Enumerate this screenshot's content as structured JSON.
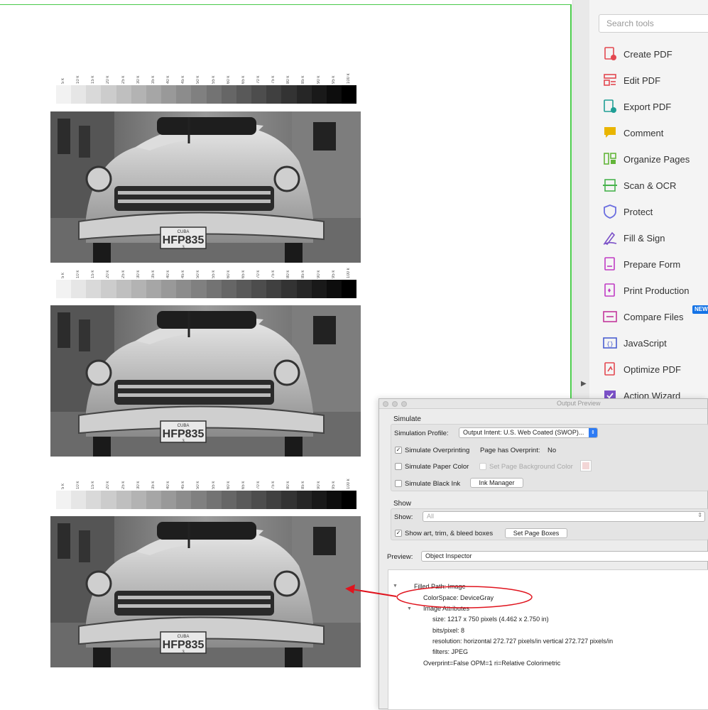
{
  "scale_labels": [
    "5 k",
    "10 k",
    "15 k",
    "20 k",
    "25 k",
    "30 k",
    "35 k",
    "40 k",
    "45 k",
    "50 k",
    "55 k",
    "60 k",
    "65 k",
    "70 k",
    "75 k",
    "80 k",
    "85 k",
    "90 k",
    "95 k",
    "100 k"
  ],
  "scale_levels_percent": [
    5,
    10,
    15,
    20,
    25,
    30,
    35,
    40,
    45,
    50,
    55,
    60,
    65,
    70,
    75,
    80,
    85,
    90,
    95,
    100
  ],
  "photo": {
    "plate": "HFP835",
    "plate_top": "CUBA",
    "plate_bottom": "3"
  },
  "tools": {
    "search_placeholder": "Search tools",
    "items": [
      {
        "label": "Create PDF",
        "icon": "create-pdf-icon",
        "color": "#e34850"
      },
      {
        "label": "Edit PDF",
        "icon": "edit-pdf-icon",
        "color": "#e34850"
      },
      {
        "label": "Export PDF",
        "icon": "export-pdf-icon",
        "color": "#1f9e95"
      },
      {
        "label": "Comment",
        "icon": "comment-icon",
        "color": "#e9b500"
      },
      {
        "label": "Organize Pages",
        "icon": "organize-pages-icon",
        "color": "#63b53a"
      },
      {
        "label": "Scan & OCR",
        "icon": "scan-ocr-icon",
        "color": "#47b24c"
      },
      {
        "label": "Protect",
        "icon": "shield-icon",
        "color": "#6b6ee0"
      },
      {
        "label": "Fill & Sign",
        "icon": "fill-sign-icon",
        "color": "#7b51c8"
      },
      {
        "label": "Prepare Form",
        "icon": "prepare-form-icon",
        "color": "#c03bc4"
      },
      {
        "label": "Print Production",
        "icon": "print-production-icon",
        "color": "#c03bc4"
      },
      {
        "label": "Compare Files",
        "icon": "compare-files-icon",
        "color": "#c3379c"
      },
      {
        "label": "JavaScript",
        "icon": "javascript-icon",
        "color": "#4b5fd0"
      },
      {
        "label": "Optimize PDF",
        "icon": "optimize-pdf-icon",
        "color": "#e34850"
      },
      {
        "label": "Action Wizard",
        "icon": "action-wizard-icon",
        "color": "#7b51c8"
      }
    ],
    "new_badge": "NEW"
  },
  "dialog": {
    "title": "Output Preview",
    "simulate_heading": "Simulate",
    "simulation_profile_label": "Simulation Profile:",
    "simulation_profile_value": "Output Intent: U.S. Web Coated (SWOP)...",
    "simulate_overprinting_label": "Simulate Overprinting",
    "simulate_overprinting_checked": true,
    "page_has_overprint_label": "Page has Overprint:",
    "page_has_overprint_value": "No",
    "simulate_paper_color_label": "Simulate Paper Color",
    "set_page_background_label": "Set Page Background Color",
    "simulate_black_ink_label": "Simulate Black Ink",
    "ink_manager_label": "Ink Manager",
    "show_heading": "Show",
    "show_label": "Show:",
    "show_value": "All",
    "show_boxes_label": "Show art, trim, & bleed boxes",
    "show_boxes_checked": true,
    "set_page_boxes_label": "Set Page Boxes",
    "preview_label": "Preview:",
    "preview_value": "Object Inspector",
    "inspector": {
      "filled_path": "Filled Path: Image",
      "colorspace": "ColorSpace: DeviceGray",
      "image_attributes": "Image Attributes",
      "size": "size: 1217 x 750 pixels (4.462 x 2.750 in)",
      "bits": "bits/pixel: 8",
      "resolution": "resolution: horizontal 272.727 pixels/in vertical 272.727 pixels/in",
      "filters": "filters: JPEG",
      "overprint": "Overprint=False OPM=1 ri=Relative Colorimetric"
    }
  },
  "annotation_color": "#e0141e"
}
